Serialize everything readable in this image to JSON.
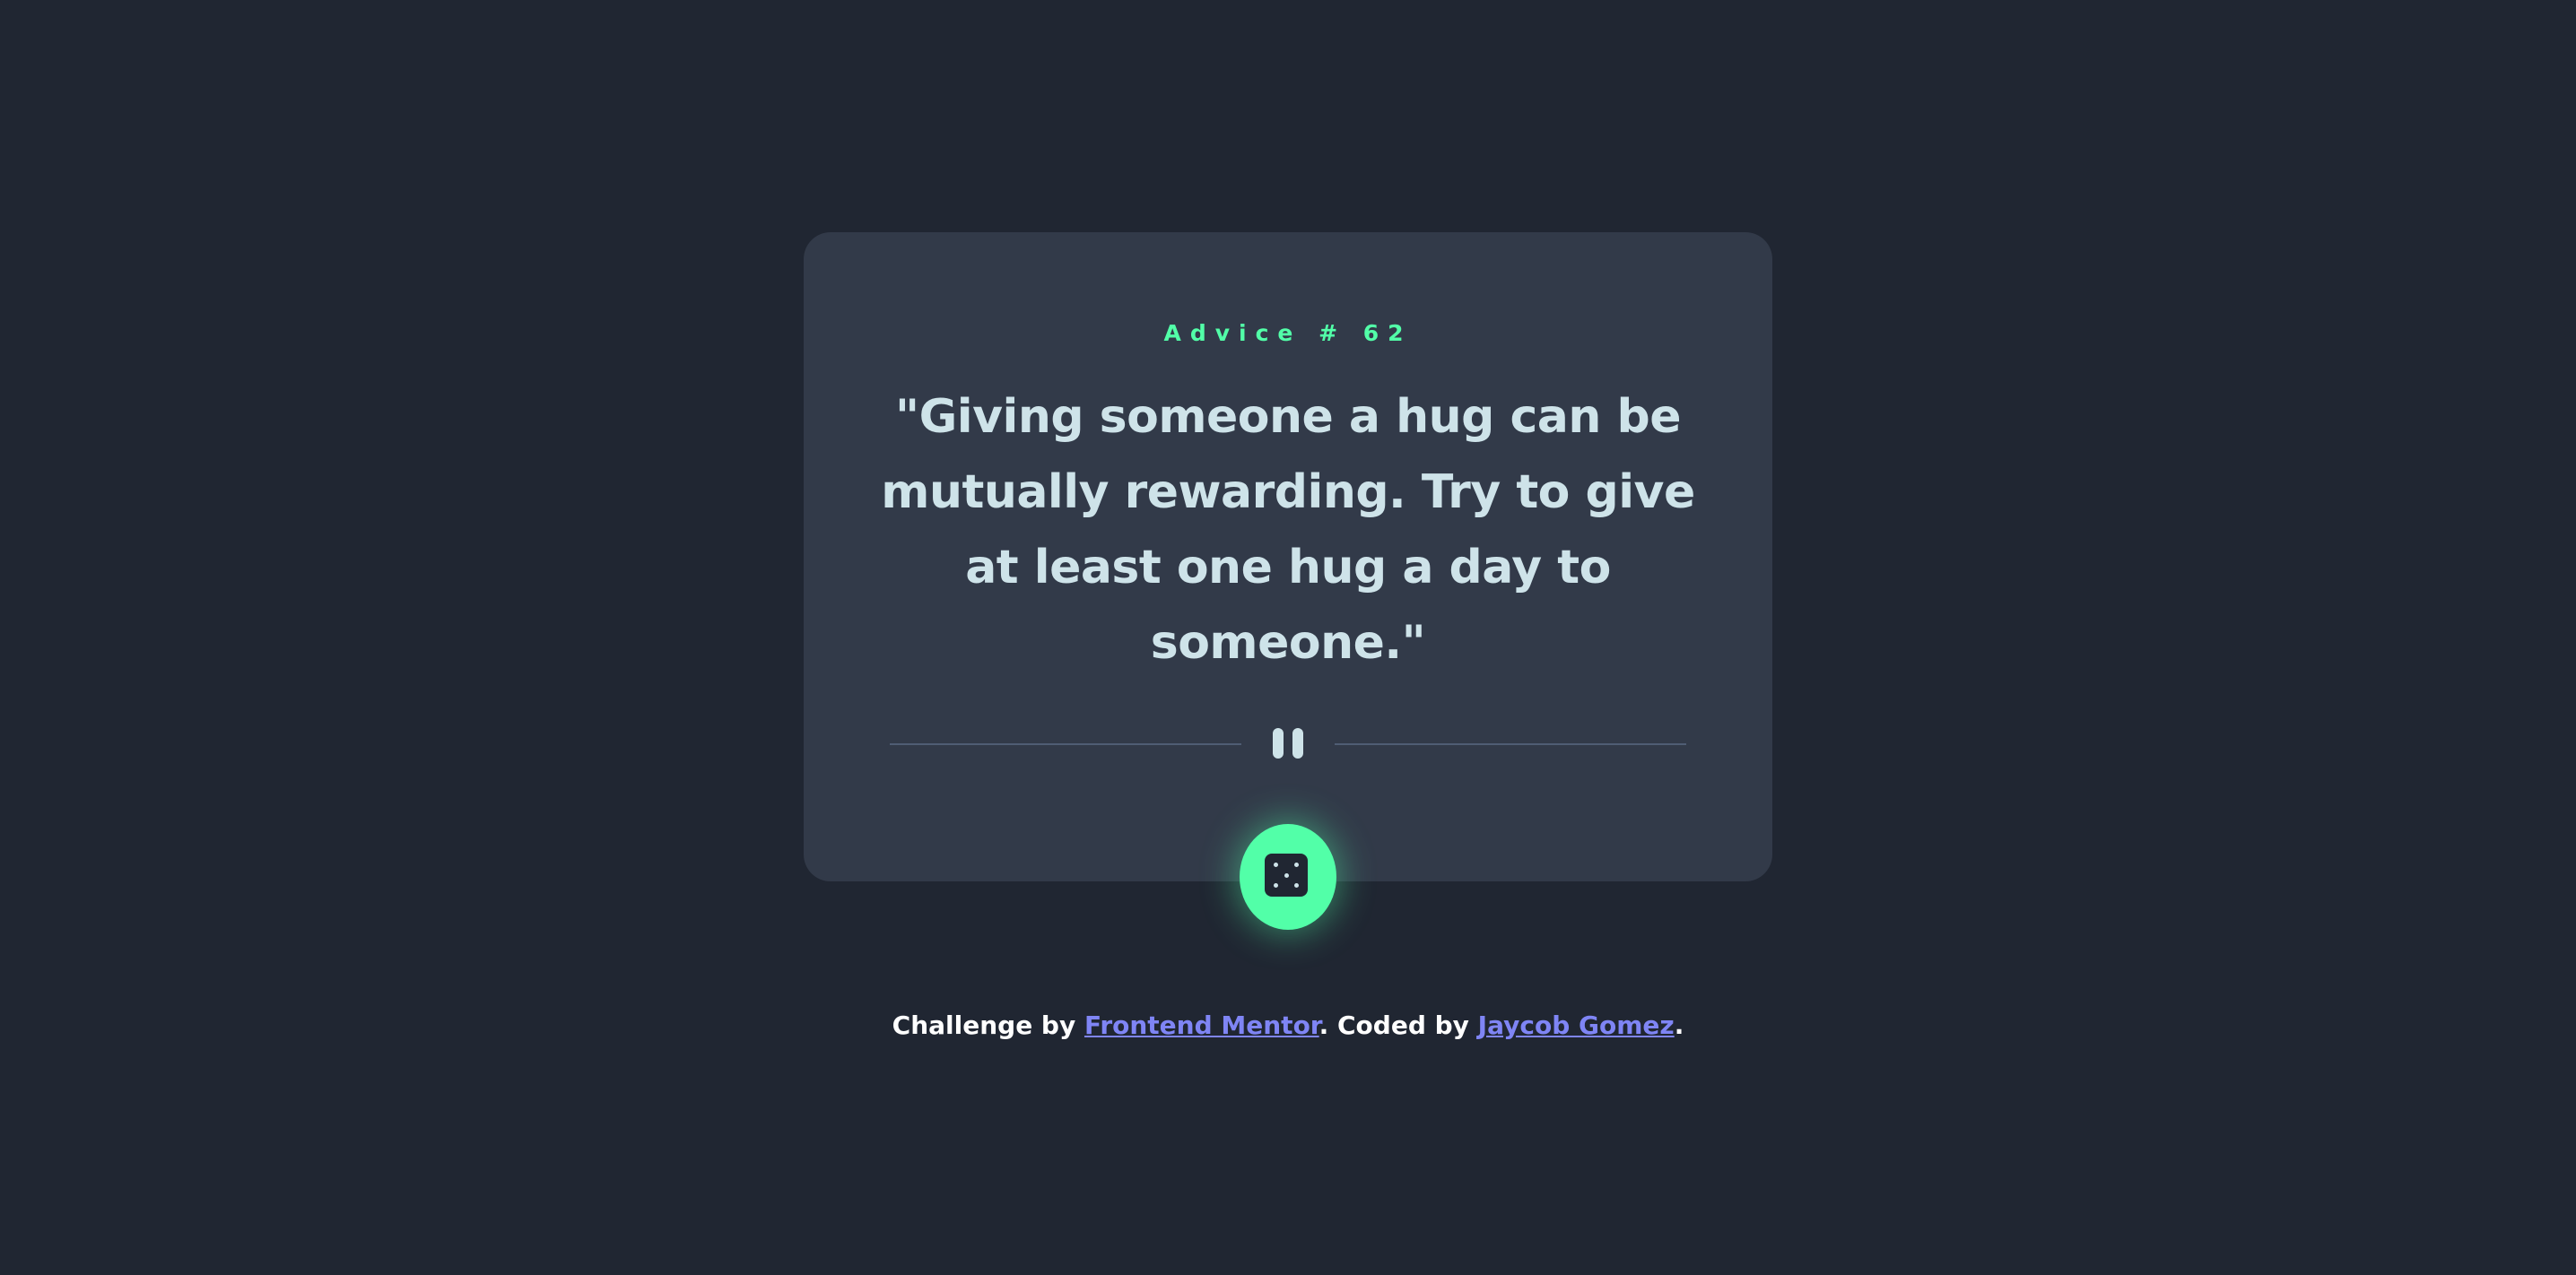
{
  "card": {
    "advice_label": "Advice # 62",
    "quote": "\"Giving someone a hug can be mutually rewarding. Try to give at least one hug a day to someone.\""
  },
  "divider": {
    "icon": "pause-icon"
  },
  "dice_button": {
    "icon": "dice-icon"
  },
  "footer": {
    "prefix": "Challenge by ",
    "challenge_link": "Frontend Mentor",
    "middle": ". Coded by ",
    "author_link": "Jaycob Gomez",
    "suffix": "."
  },
  "colors": {
    "background": "#202632",
    "card": "#323a49",
    "accent": "#52ffa8",
    "text": "#cee3e9",
    "link": "#7f85f5"
  }
}
